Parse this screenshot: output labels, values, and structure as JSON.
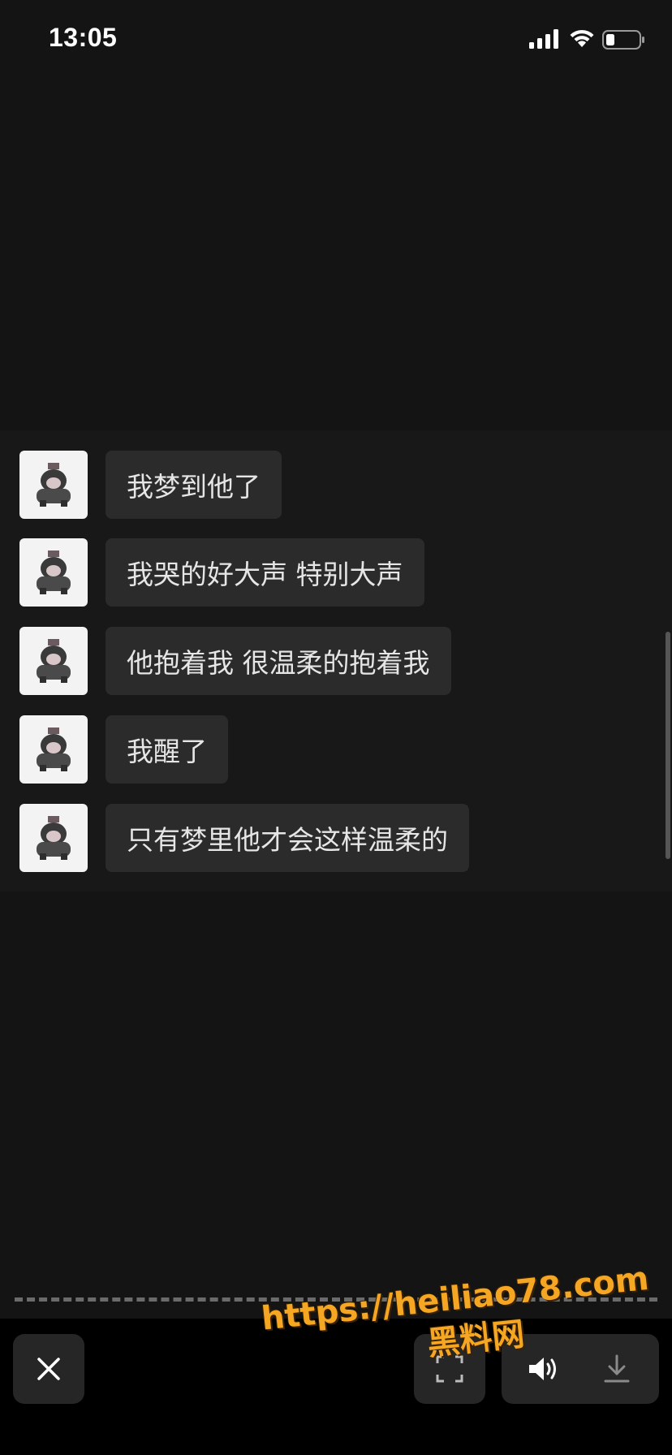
{
  "status_bar": {
    "time": "13:05",
    "icons": [
      "signal-icon",
      "wifi-icon",
      "battery-icon"
    ]
  },
  "chat": {
    "messages": [
      {
        "text": "我梦到他了"
      },
      {
        "text": "我哭的好大声 特别大声"
      },
      {
        "text": "他抱着我 很温柔的抱着我"
      },
      {
        "text": "我醒了"
      },
      {
        "text": "只有梦里他才会这样温柔的"
      }
    ]
  },
  "controls": {
    "icons": [
      "close-icon",
      "scan-icon",
      "speaker-icon",
      "download-icon"
    ]
  },
  "watermark": {
    "url": "https://heiliao78.com",
    "site_name": "黑料网",
    "color": "#f5a623"
  }
}
